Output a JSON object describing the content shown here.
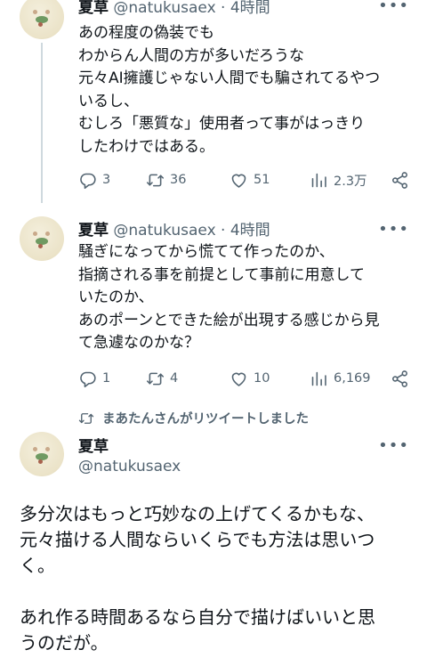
{
  "tweets": [
    {
      "name": "夏草",
      "handle": "@natukusaex",
      "time": "· 4時間",
      "text": "あの程度の偽装でも\nわからん人間の方が多いだろうな\n元々AI擁護じゃない人間でも騙されてるやつ\nいるし、\nむしろ「悪質な」使用者って事がはっきり\nしたわけではある。",
      "replies": "3",
      "retweets": "36",
      "likes": "51",
      "views": "2.3万"
    },
    {
      "name": "夏草",
      "handle": "@natukusaex",
      "time": "· 4時間",
      "text": "騒ぎになってから慌てて作ったのか、\n指摘される事を前提として事前に用意して\nいたのか、\nあのポーンとできた絵が出現する感じから見\nて急遽なのかな？",
      "replies": "1",
      "retweets": "4",
      "likes": "10",
      "views": "6,169"
    }
  ],
  "retweet_notice": "まあたんさんがリツイートしました",
  "main_tweet": {
    "name": "夏草",
    "handle": "@natukusaex",
    "text": "多分次はもっと巧妙なの上げてくるかもな、\n元々描ける人間ならいくらでも方法は思いつ\nく。\n\nあれ作る時間あるなら自分で描けばいいと思\nうのだが。"
  },
  "icons": [
    "reply-icon",
    "retweet-icon",
    "like-icon",
    "views-icon",
    "share-icon",
    "more-icon"
  ],
  "colors": {
    "text": "#0f1419",
    "secondary": "#536471",
    "thread_line": "#cfd9de"
  }
}
